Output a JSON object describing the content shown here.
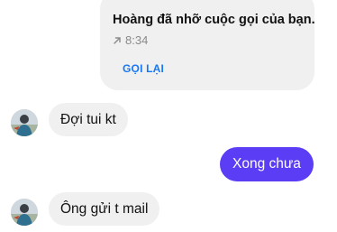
{
  "call_card": {
    "title": "Hoàng đã nhỡ cuộc gọi của bạn.",
    "time": "8:34",
    "call_back_label": "GỌI LẠI"
  },
  "messages": [
    {
      "direction": "incoming",
      "text": "Đợi tui kt"
    },
    {
      "direction": "outgoing",
      "text": "Xong chưa"
    },
    {
      "direction": "incoming",
      "text": "Ông gửi t mail"
    }
  ],
  "colors": {
    "incoming_bubble": "#f0f0f0",
    "outgoing_bubble": "#5b3df5",
    "call_back_link": "#1877f2"
  },
  "icons": {
    "missed_call": "arrow-up-right-icon",
    "sender_avatar": "avatar"
  }
}
